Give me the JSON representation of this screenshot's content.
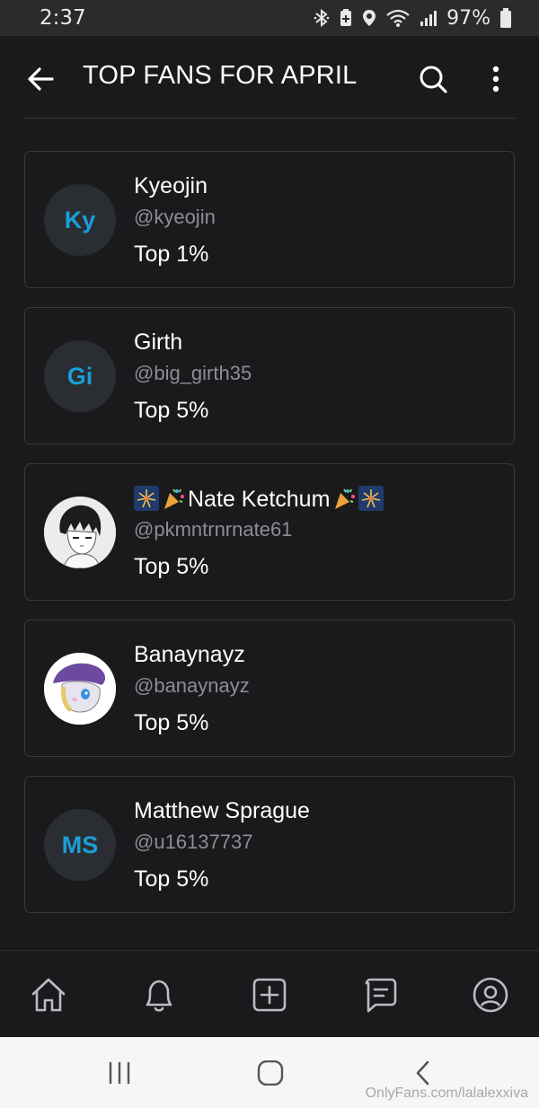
{
  "status_bar": {
    "time": "2:37",
    "battery": "97%",
    "icons": [
      "bluetooth-icon",
      "battery-saver-icon",
      "location-icon",
      "wifi-icon",
      "signal-icon",
      "battery-icon"
    ]
  },
  "header": {
    "title": "TOP FANS FOR APRIL",
    "back_icon": "arrow-left-icon",
    "search_icon": "search-icon",
    "more_icon": "more-vertical-icon"
  },
  "fans": [
    {
      "name": "Kyeojin",
      "handle": "@kyeojin",
      "rank": "Top 1%",
      "initials": "Ky",
      "avatar": "initials"
    },
    {
      "name": "Girth",
      "handle": "@big_girth35",
      "rank": "Top 5%",
      "initials": "Gi",
      "avatar": "initials"
    },
    {
      "name": "Nate Ketchum",
      "name_emoji": [
        "fireworks",
        "party-popper"
      ],
      "handle": "@pkmntrnrnate61",
      "rank": "Top 5%",
      "avatar": "anime-portrait"
    },
    {
      "name": "Banaynayz",
      "handle": "@banaynayz",
      "rank": "Top 5%",
      "avatar": "pony-portrait"
    },
    {
      "name": "Matthew Sprague",
      "handle": "@u16137737",
      "rank": "Top 5%",
      "initials": "MS",
      "avatar": "initials"
    }
  ],
  "tab_bar": {
    "items": [
      "home-icon",
      "bell-icon",
      "plus-square-icon",
      "chat-icon",
      "profile-icon"
    ]
  },
  "system_nav": {
    "buttons": [
      "recents-icon",
      "home-circle-icon",
      "back-chevron-icon"
    ],
    "watermark": "OnlyFans.com/lalalexxiva"
  },
  "colors": {
    "background": "#1a1a1c",
    "accent": "#1a9ed8",
    "secondary_text": "#8b8e94",
    "border": "#3a3a3e"
  }
}
